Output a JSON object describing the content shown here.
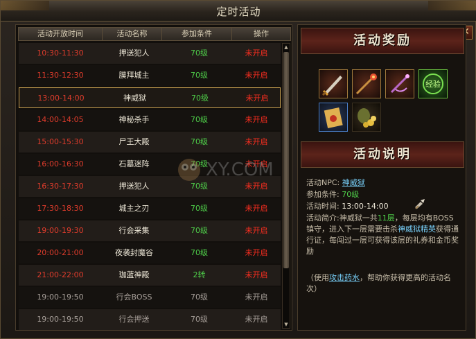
{
  "window": {
    "title": "定时活动",
    "close_glyph": "✕"
  },
  "table": {
    "headers": [
      "活动开放时间",
      "活动名称",
      "参加条件",
      "操作"
    ],
    "rows": [
      {
        "time": "10:30-11:30",
        "name": "押送犯人",
        "cond": "70级",
        "op": "未开启"
      },
      {
        "time": "11:30-12:30",
        "name": "膜拜城主",
        "cond": "70级",
        "op": "未开启"
      },
      {
        "time": "13:00-14:00",
        "name": "神威狱",
        "cond": "70级",
        "op": "未开启"
      },
      {
        "time": "14:00-14:05",
        "name": "神秘杀手",
        "cond": "70级",
        "op": "未开启"
      },
      {
        "time": "15:00-15:30",
        "name": "尸王大殿",
        "cond": "70级",
        "op": "未开启"
      },
      {
        "time": "16:00-16:30",
        "name": "石墓迷阵",
        "cond": "70级",
        "op": "未开启"
      },
      {
        "time": "16:30-17:30",
        "name": "押送犯人",
        "cond": "70级",
        "op": "未开启"
      },
      {
        "time": "17:30-18:30",
        "name": "城主之刃",
        "cond": "70级",
        "op": "未开启"
      },
      {
        "time": "19:00-19:30",
        "name": "行会采集",
        "cond": "70级",
        "op": "未开启"
      },
      {
        "time": "20:00-21:00",
        "name": "夜袭封魔谷",
        "cond": "70级",
        "op": "未开启"
      },
      {
        "time": "21:00-22:00",
        "name": "珈蓝神殿",
        "cond": "2转",
        "op": "未开启"
      },
      {
        "time": "19:00-19:50",
        "name": "行会BOSS",
        "cond": "70级",
        "op": "未开启"
      },
      {
        "time": "19:00-19:50",
        "name": "行会押送",
        "cond": "70级",
        "op": "未开启"
      }
    ],
    "selected_index": 2,
    "grey_from_index": 11,
    "scroll_up_glyph": "▲",
    "scroll_down_glyph": "▼"
  },
  "reward": {
    "title": "活动奖励",
    "items": [
      {
        "icon": "sword-icon"
      },
      {
        "icon": "staff-icon"
      },
      {
        "icon": "wand-icon"
      },
      {
        "icon": "experience-orb-icon",
        "label": "经验"
      },
      {
        "icon": "scroll-icon"
      },
      {
        "icon": "gold-coins-icon"
      }
    ]
  },
  "description": {
    "title": "活动说明",
    "npc_label": "活动NPC:",
    "npc_value": "神威狱",
    "cond_label": "参加条件:",
    "cond_value": "70级",
    "time_label": "活动时间:",
    "time_value": "13:00-14:00",
    "intro_label": "活动简介:",
    "intro_part1": "神威狱一共",
    "intro_floors": "11层",
    "intro_part2": "，每层均有BOSS镇守，进入下一层需要击杀",
    "intro_elite": "神威狱精英",
    "intro_part3": "获得通行证，每闯过一层可获得该层的礼券和金币奖励",
    "note_part1": "（使用",
    "note_link": "攻击药水",
    "note_part2": "，帮助你获得更高的活动名次）"
  },
  "watermark": {
    "text": "XY.COM"
  },
  "colors": {
    "time_red": "#e03c2c",
    "cond_green": "#4fd04a",
    "op_red": "#ff2e20",
    "selected_border": "#c8a050",
    "link_blue": "#7ad4ff"
  }
}
